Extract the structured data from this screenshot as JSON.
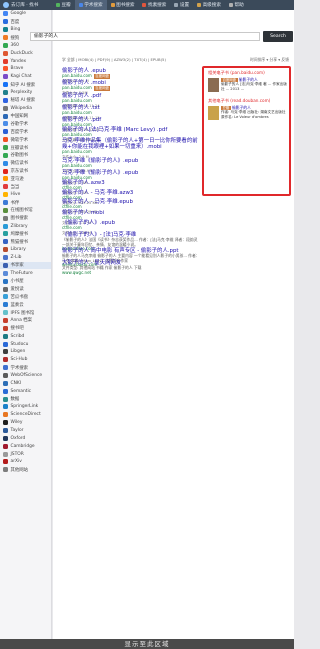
{
  "topbar": {
    "brand": "去订库 · 找书",
    "tabs": [
      {
        "label": "豆瓣",
        "color": "#53b55e",
        "active": false
      },
      {
        "label": "学术搜索",
        "color": "#4a86e8",
        "active": true
      },
      {
        "label": "图书搜索",
        "color": "#e09b3d",
        "active": false
      },
      {
        "label": "找素搜索",
        "color": "#e0563d",
        "active": false
      },
      {
        "label": "设置",
        "color": "#9aa7b4",
        "active": false
      },
      {
        "label": "高级搜索",
        "color": "#d2a24c",
        "active": false
      },
      {
        "label": "帮助",
        "color": "#b0b0b0",
        "active": false
      }
    ]
  },
  "sidebar": [
    {
      "label": "Google",
      "color": "#4285f4"
    },
    {
      "label": "百度",
      "color": "#2b6de0"
    },
    {
      "label": "Bing",
      "color": "#14838f"
    },
    {
      "label": "搜狗",
      "color": "#f07b25"
    },
    {
      "label": "360",
      "color": "#32a852"
    },
    {
      "label": "DuckDuck",
      "color": "#de5833"
    },
    {
      "label": "Yandex",
      "color": "#e23c2c"
    },
    {
      "label": "Brave",
      "color": "#fb542b"
    },
    {
      "label": "Kagi Chat",
      "color": "#7a4cc8"
    },
    {
      "label": "知乎 AI 搜索",
      "color": "#1772f6"
    },
    {
      "label": "Perplexity",
      "color": "#20808d"
    },
    {
      "label": "秘塔 AI 搜索",
      "color": "#2f62e0"
    },
    {
      "label": "Wikipedia",
      "color": "#777777"
    },
    {
      "label": "中国知网",
      "color": "#2c69b6"
    },
    {
      "label": "谷歌学术",
      "color": "#4b8de8"
    },
    {
      "label": "百度学术",
      "color": "#2b5fd6"
    },
    {
      "label": "微软学术",
      "color": "#f25022"
    },
    {
      "label": "豆瓣读书",
      "color": "#3aa24b"
    },
    {
      "label": "谷歌图书",
      "color": "#34a853"
    },
    {
      "label": "微信读书",
      "color": "#2e8be6"
    },
    {
      "label": "京东读书",
      "color": "#e1251b"
    },
    {
      "label": "亚马逊",
      "color": "#ff9900"
    },
    {
      "label": "当当",
      "color": "#e13c3c"
    },
    {
      "label": "Hive",
      "color": "#ffb300"
    },
    {
      "label": "书伴",
      "color": "#3e7bd6"
    },
    {
      "label": "在线图书馆",
      "color": "#5a8f3e"
    },
    {
      "label": "图书搜索",
      "color": "#7a7a7a"
    },
    {
      "label": "Zlibrary",
      "color": "#2a9bd8"
    },
    {
      "label": "鸠摩搜书",
      "color": "#29a0a0"
    },
    {
      "label": "熊猫搜书",
      "color": "#3563c4"
    },
    {
      "label": "Library",
      "color": "#b84c2e"
    },
    {
      "label": "Z-Lib",
      "color": "#4a72c9"
    },
    {
      "label": "书享家",
      "color": "#3a5fb0",
      "active": true
    },
    {
      "label": "TheFuture",
      "color": "#5b8bd9"
    },
    {
      "label": "小书屋",
      "color": "#2a74c3"
    },
    {
      "label": "爱悦读",
      "color": "#6a6a6a"
    },
    {
      "label": "苦瓜书盘",
      "color": "#39a0d8"
    },
    {
      "label": "蓝奏云",
      "color": "#2b7cd3"
    },
    {
      "label": "IPFS 图书馆",
      "color": "#65c2cb"
    },
    {
      "label": "Anna 档案",
      "color": "#c7402d"
    },
    {
      "label": "搜书吧",
      "color": "#c2402d"
    },
    {
      "label": "Scribd",
      "color": "#1e7b85"
    },
    {
      "label": "Studocu",
      "color": "#2b6ad8"
    },
    {
      "label": "Libgen",
      "color": "#3f3f3f"
    },
    {
      "label": "Sci-Hub",
      "color": "#b22b2b"
    },
    {
      "label": "学术搜索",
      "color": "#3e6fcf"
    },
    {
      "label": "WebOfScience",
      "color": "#5b5b5b"
    },
    {
      "label": "CNKI",
      "color": "#2e6fb6"
    },
    {
      "label": "Semantic",
      "color": "#2b6bd6"
    },
    {
      "label": "数据",
      "color": "#2a8f8f"
    },
    {
      "label": "SpringerLink",
      "color": "#1c82c9"
    },
    {
      "label": "ScienceDirect",
      "color": "#e87722"
    },
    {
      "label": "Wiley",
      "color": "#1d1d1d"
    },
    {
      "label": "Taylor",
      "color": "#2b5a9a"
    },
    {
      "label": "Oxford",
      "color": "#22385b"
    },
    {
      "label": "Cambridge",
      "color": "#a1192e"
    },
    {
      "label": "JSTOR",
      "color": "#9a9a9a"
    },
    {
      "label": "arXiv",
      "color": "#b31b1b"
    },
    {
      "label": "其他网站",
      "color": "#7d7d7d"
    }
  ],
  "search": {
    "query": "偷影子的人",
    "button": "Search",
    "filters": "学 全部 | MOBI(4) | PDF(9) | AZW3(2) | TXT(4) | EPUB(5)",
    "tools": "时间排序 ▾ 分享 ▾ 反馈"
  },
  "results": [
    {
      "title": "偷影子的人 .epub",
      "url": "pan.baidu.com",
      "tag": "百度网盘",
      "meta": "文件大小: 1.1 M"
    },
    {
      "title": "偷影子的人 .mobi",
      "url": "pan.baidu.com",
      "tag": "百度网盘",
      "meta": "文件大小: 3.5M"
    },
    {
      "title": "偷影子的人 .pdf",
      "url": "pan.baidu.com",
      "meta": "分享日期: 2016-11-24"
    },
    {
      "title": "偷影子的人 .txt",
      "url": "pan.baidu.com",
      "meta": "分享日期: 2016-11-15"
    },
    {
      "title": "偷影子的人 .pdf",
      "url": "pan.baidu.com",
      "meta": "分享日期: 2016-11-15"
    },
    {
      "title": "偷影子的人[法]马克·李维 (Marc Levy) .pdf",
      "url": "pan.baidu.com",
      "meta": "分享日期: 2016-04-13"
    },
    {
      "title": "马克·李维作品集（偷影子的人+第一日一比你所要看的前幾+你能在我眼裡+如果一切重来）.mobi",
      "url": "pan.baidu.com",
      "meta": "文件大小: 2.9 M"
    },
    {
      "title": "马克·李维《偷影子的人》.epub",
      "url": "pan.baidu.com",
      "meta": "文件大小: 288.9 K"
    },
    {
      "title": "马克·李维《偷影子的人》.epub",
      "url": "pan.baidu.com",
      "meta": "文件大小: 1.3M"
    },
    {
      "title": "偷影子的人.azw3",
      "url": "ctfile.com",
      "meta": "文件大小: 3.2M"
    },
    {
      "title": "偷影子的人 - 马克·李维.azw3",
      "url": "ctfile.com",
      "meta": "文件大小: 635.25 KB"
    },
    {
      "title": "偷影子的人 - 马克·李维.epub",
      "url": "ctfile.com",
      "meta": "文件大小: 385.29 KB"
    },
    {
      "title": "偷影子的人.mobi",
      "url": "ctfile.com",
      "meta": "文件大小: 1.17 M"
    },
    {
      "title": "《偷影子的人》.epub",
      "url": "ctfile.com",
      "meta": "文件大小: 3.36 M"
    },
    {
      "title": "《偷影子的人》- [法]马克·李维",
      "url": "kuxiaoshuo.com",
      "snippet": "《偷影子的人》法国《读书》杂志获奖作品... 作者：[法]马克·李维 译者：段韵灵 一部关于童年回忆、亲情、友谊的温暖小说。"
    },
    {
      "title": "偷影子的人 简中电影 有声专区 - 偷影子的人.ppt",
      "url": "wenku.baidu.com",
      "snippet": "偷影子的人马克李维 偷影子的人 主要内容 一个能看见别人影子的小男孩... 作者：马克·李维（Marc Levy）法国知名作家"
    },
    {
      "title": "大影子的人 - 星天网网友",
      "url": "www.qwgc.net",
      "snippet": "文件类型: 其他网站 书籍 作家 偷影子的人 下载"
    }
  ],
  "right_panel": [
    {
      "head": "相关电子书 (pan.baidu.com)",
      "title": "偷影子的人",
      "tag": "百度网盘",
      "desc": "偷影子的人 [法]马克·李维 著 ... 作家出版社 ... 2013 ...",
      "thumb_color": "#8a6c52"
    },
    {
      "head": "其他电子书 (read.douban.com)",
      "title": "偷影子的人",
      "tag": "豆瓣",
      "desc": "作者: 马克·李维  出版社: 湖南文艺出版社  原作名: Le Voleur d'ombres",
      "thumb_color": "#c9a24a"
    }
  ],
  "footer": {
    "text": "显示至此区域"
  }
}
